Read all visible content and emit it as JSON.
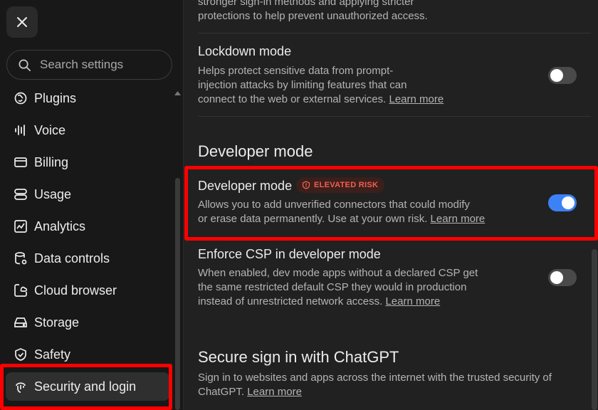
{
  "sidebar": {
    "search_placeholder": "Search settings",
    "items": [
      {
        "label": "Plugins",
        "icon": "plugins-icon"
      },
      {
        "label": "Voice",
        "icon": "voice-icon"
      },
      {
        "label": "Billing",
        "icon": "billing-icon"
      },
      {
        "label": "Usage",
        "icon": "usage-icon"
      },
      {
        "label": "Analytics",
        "icon": "analytics-icon"
      },
      {
        "label": "Data controls",
        "icon": "data-controls-icon"
      },
      {
        "label": "Cloud browser",
        "icon": "cloud-browser-icon"
      },
      {
        "label": "Storage",
        "icon": "storage-icon"
      },
      {
        "label": "Safety",
        "icon": "safety-icon"
      },
      {
        "label": "Security and login",
        "icon": "security-login-icon",
        "active": true
      }
    ]
  },
  "main": {
    "prev_desc_tail_line1": "stronger sign-in methods and applying stricter",
    "prev_desc_tail_line2": "protections to help prevent unauthorized access.",
    "lockdown": {
      "title": "Lockdown mode",
      "desc_line1": "Helps protect sensitive data from prompt-",
      "desc_line2": "injection attacks by limiting features that can",
      "desc_line3": "connect to the web or external services.",
      "learn_more": "Learn more",
      "enabled": false
    },
    "developer_section_heading": "Developer mode",
    "developer_mode": {
      "title": "Developer mode",
      "badge": "ELEVATED RISK",
      "desc_line1": "Allows you to add unverified connectors that could modify",
      "desc_line2": "or erase data permanently. Use at your own risk.",
      "learn_more": "Learn more",
      "enabled": true
    },
    "enforce_csp": {
      "title": "Enforce CSP in developer mode",
      "desc_line1": "When enabled, dev mode apps without a declared CSP get",
      "desc_line2": "the same restricted default CSP they would in production",
      "desc_line3": "instead of unrestricted network access.",
      "learn_more": "Learn more",
      "enabled": false
    },
    "secure_signin": {
      "heading": "Secure sign in with ChatGPT",
      "desc_line1": "Sign in to websites and apps across the internet with the trusted security of",
      "desc_line2": "ChatGPT.",
      "learn_more": "Learn more"
    }
  },
  "colors": {
    "accent": "#3b82f6",
    "highlight": "#ff0000",
    "badge_text": "#f0604f"
  }
}
